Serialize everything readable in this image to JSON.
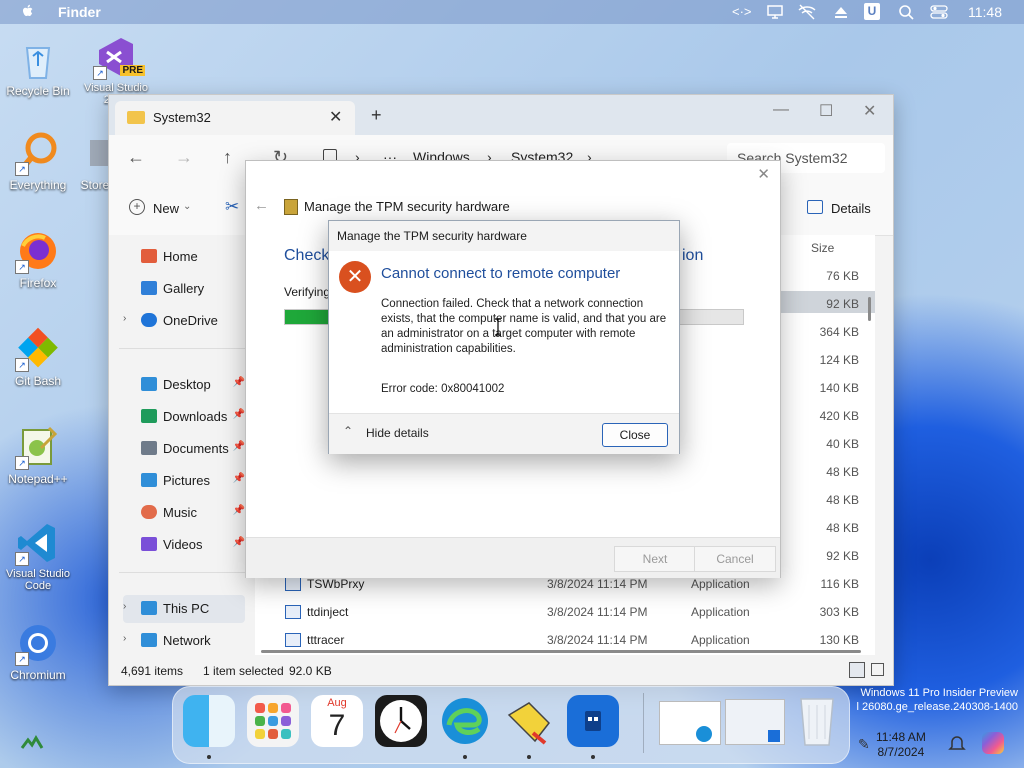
{
  "menubar": {
    "app_name": "Finder",
    "clock": "11:48",
    "icons": [
      "apple-icon",
      "code-arrows-icon",
      "display-icon",
      "wifi-off-icon",
      "eject-icon",
      "user-icon",
      "search-icon",
      "control-center-icon"
    ]
  },
  "desktop_icons": [
    {
      "label": "Recycle Bin",
      "icon": "recycle-bin-icon",
      "color": "#7fb2e6"
    },
    {
      "label": "Visual Studio 2022",
      "icon": "visual-studio-icon",
      "color": "#8a4fd1",
      "badge": "PRE"
    },
    {
      "label": "Everything",
      "icon": "everything-search-icon",
      "color": "#f08a1e"
    },
    {
      "label": "Store",
      "icon": "store-icon",
      "color": "#7f8fa6"
    },
    {
      "label": "Firefox",
      "icon": "firefox-icon",
      "color": "#ff7a18"
    },
    {
      "label": "Git Bash",
      "icon": "git-bash-icon",
      "color": "#4caf50"
    },
    {
      "label": "Notepad++",
      "icon": "notepadpp-icon",
      "color": "#8bc34a"
    },
    {
      "label": "Visual Studio Code",
      "icon": "vscode-icon",
      "color": "#1f8ad2"
    },
    {
      "label": "Chromium",
      "icon": "chromium-icon",
      "color": "#3a7be0"
    }
  ],
  "explorer": {
    "tab_title": "System32",
    "breadcrumb": [
      "Windows",
      "System32"
    ],
    "search_placeholder": "Search System32",
    "new_label": "New",
    "details_label": "Details",
    "size_header": "Size",
    "sidebar": [
      {
        "label": "Home",
        "icon": "home-icon",
        "color": "#e25d3c"
      },
      {
        "label": "Gallery",
        "icon": "gallery-icon",
        "color": "#2f7fd8"
      },
      {
        "label": "OneDrive",
        "icon": "onedrive-icon",
        "color": "#1f74d8"
      },
      {
        "label": "Desktop",
        "icon": "desktop-icon",
        "color": "#2f8ed8"
      },
      {
        "label": "Downloads",
        "icon": "downloads-icon",
        "color": "#1f9b5b"
      },
      {
        "label": "Documents",
        "icon": "documents-icon",
        "color": "#6f7b8a"
      },
      {
        "label": "Pictures",
        "icon": "pictures-icon",
        "color": "#2f8ed8"
      },
      {
        "label": "Music",
        "icon": "music-icon",
        "color": "#e26b4a"
      },
      {
        "label": "Videos",
        "icon": "videos-icon",
        "color": "#7a4fd8"
      },
      {
        "label": "This PC",
        "icon": "this-pc-icon",
        "color": "#2f8ed8"
      },
      {
        "label": "Network",
        "icon": "network-icon",
        "color": "#2f8ed8"
      }
    ],
    "sizes": [
      "76 KB",
      "92 KB",
      "364 KB",
      "124 KB",
      "140 KB",
      "420 KB",
      "40 KB",
      "48 KB",
      "48 KB",
      "48 KB",
      "92 KB"
    ],
    "files": [
      {
        "name": "TSWbPrxy",
        "date": "3/8/2024 11:14 PM",
        "type": "Application",
        "size": "116 KB"
      },
      {
        "name": "ttdinject",
        "date": "3/8/2024 11:14 PM",
        "type": "Application",
        "size": "303 KB"
      },
      {
        "name": "tttracer",
        "date": "3/8/2024 11:14 PM",
        "type": "Application",
        "size": "130 KB"
      }
    ],
    "status": {
      "items": "4,691 items",
      "selected": "1 item selected",
      "size": "92.0 KB"
    }
  },
  "wizard": {
    "title": "Manage the TPM security hardware",
    "heading_left": "Checki",
    "heading_right": "ion",
    "verifying": "Verifying",
    "progress": 0.1,
    "next_label": "Next",
    "cancel_label": "Cancel"
  },
  "error_dialog": {
    "title": "Manage the TPM security hardware",
    "heading": "Cannot connect to remote computer",
    "message": "Connection failed. Check that a network connection exists, that the computer name is valid, and that you are an administrator on a target computer with remote administration capabilities.",
    "error_code": "Error code: 0x80041002",
    "hide_details": "Hide details",
    "close_label": "Close"
  },
  "dock": {
    "calendar_month": "Aug",
    "calendar_day": "7",
    "apps": [
      "finder-icon",
      "launchpad-icon",
      "calendar-icon",
      "clock-icon",
      "edge-icon",
      "pointer-app-icon",
      "windows-store-icon",
      "edge-window-thumbnail-icon",
      "window-thumbnail-icon",
      "trash-icon"
    ]
  },
  "watermark": {
    "line1": "Windows 11 Pro Insider Preview",
    "line2": "l 26080.ge_release.240308-1400"
  },
  "taskbar": {
    "time": "11:48 AM",
    "date": "8/7/2024"
  }
}
